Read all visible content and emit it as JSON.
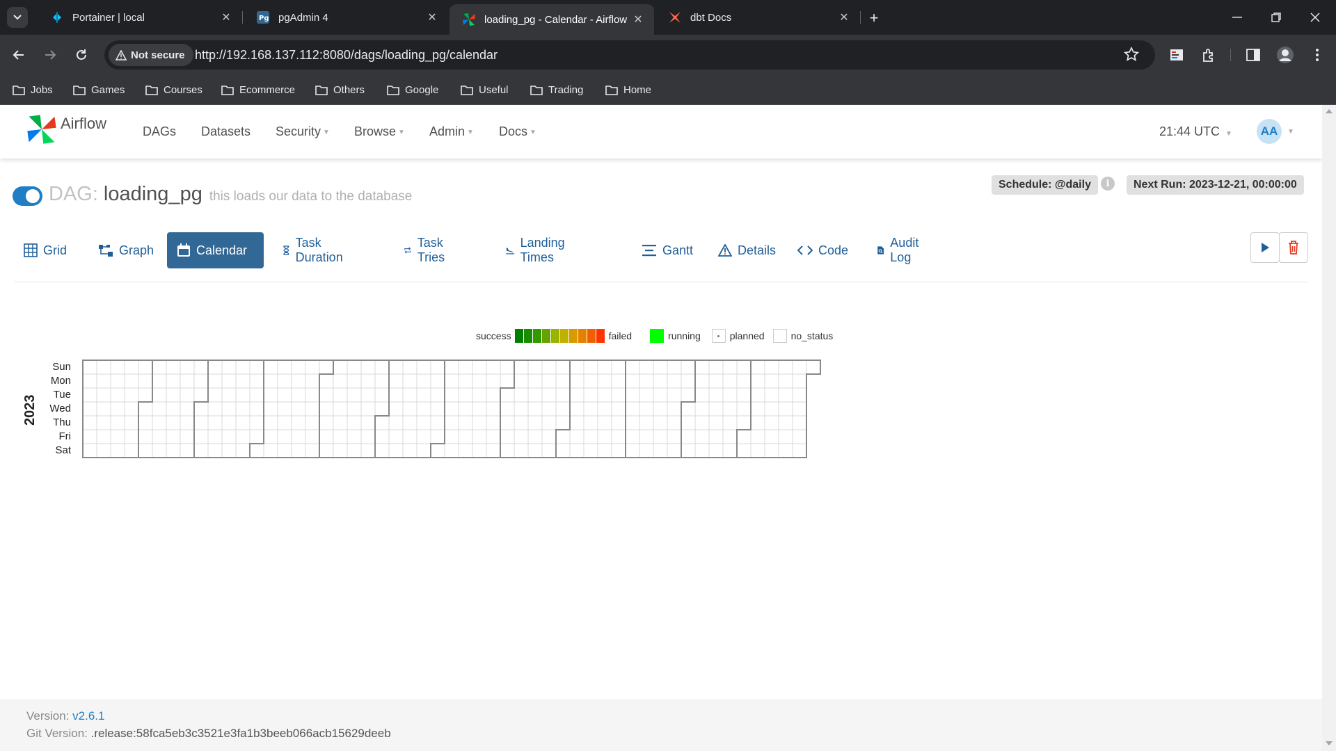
{
  "browser": {
    "tabs": [
      {
        "title": "Portainer | local",
        "icon": "portainer-icon",
        "active": false
      },
      {
        "title": "pgAdmin 4",
        "icon": "pgadmin-icon",
        "active": false
      },
      {
        "title": "loading_pg - Calendar - Airflow",
        "icon": "airflow-icon",
        "active": true
      },
      {
        "title": "dbt Docs",
        "icon": "dbt-icon",
        "active": false
      }
    ],
    "security_label": "Not secure",
    "url": "http://192.168.137.112:8080/dags/loading_pg/calendar",
    "bookmarks": [
      "Jobs",
      "Games",
      "Courses",
      "Ecommerce",
      "Others",
      "Google",
      "Useful",
      "Trading",
      "Home"
    ]
  },
  "airflow": {
    "brand": "Airflow",
    "menu": [
      {
        "label": "DAGs",
        "dropdown": false
      },
      {
        "label": "Datasets",
        "dropdown": false
      },
      {
        "label": "Security",
        "dropdown": true
      },
      {
        "label": "Browse",
        "dropdown": true
      },
      {
        "label": "Admin",
        "dropdown": true
      },
      {
        "label": "Docs",
        "dropdown": true
      }
    ],
    "time": "21:44 UTC",
    "avatar": "AA"
  },
  "dag": {
    "label": "DAG:",
    "id": "loading_pg",
    "description": "this loads our data to the database",
    "paused": false,
    "schedule": "Schedule: @daily",
    "next_run": "Next Run: 2023-12-21, 00:00:00",
    "tabs": [
      {
        "label": "Grid",
        "icon": "grid-icon",
        "active": false
      },
      {
        "label": "Graph",
        "icon": "graph-icon",
        "active": false
      },
      {
        "label": "Calendar",
        "icon": "calendar-icon",
        "active": true
      },
      {
        "label": "Task Duration",
        "icon": "hourglass-icon",
        "active": false
      },
      {
        "label": "Task Tries",
        "icon": "repeat-icon",
        "active": false
      },
      {
        "label": "Landing Times",
        "icon": "plane-landing-icon",
        "active": false
      },
      {
        "label": "Gantt",
        "icon": "gantt-icon",
        "active": false
      },
      {
        "label": "Details",
        "icon": "warning-triangle-icon",
        "active": false
      },
      {
        "label": "Code",
        "icon": "code-icon",
        "active": false
      },
      {
        "label": "Audit Log",
        "icon": "audit-log-icon",
        "active": false
      }
    ]
  },
  "calendar": {
    "legend": {
      "success": "success",
      "failed": "failed",
      "running": "running",
      "planned": "planned",
      "no_status": "no_status"
    },
    "gradient_colors": [
      "#008000",
      "#1a8c00",
      "#339900",
      "#66a300",
      "#99b300",
      "#c0b000",
      "#d99a00",
      "#e68000",
      "#f06000",
      "#ff3300"
    ],
    "running_color": "#00ff00",
    "days": [
      "Sun",
      "Mon",
      "Tue",
      "Wed",
      "Thu",
      "Fri",
      "Sat"
    ],
    "year": "2023"
  },
  "footer": {
    "version_label": "Version:",
    "version": "v2.6.1",
    "git_label": "Git Version:",
    "git": ".release:58fca5eb3c3521e3fa1b3beeb066acb15629deeb"
  }
}
